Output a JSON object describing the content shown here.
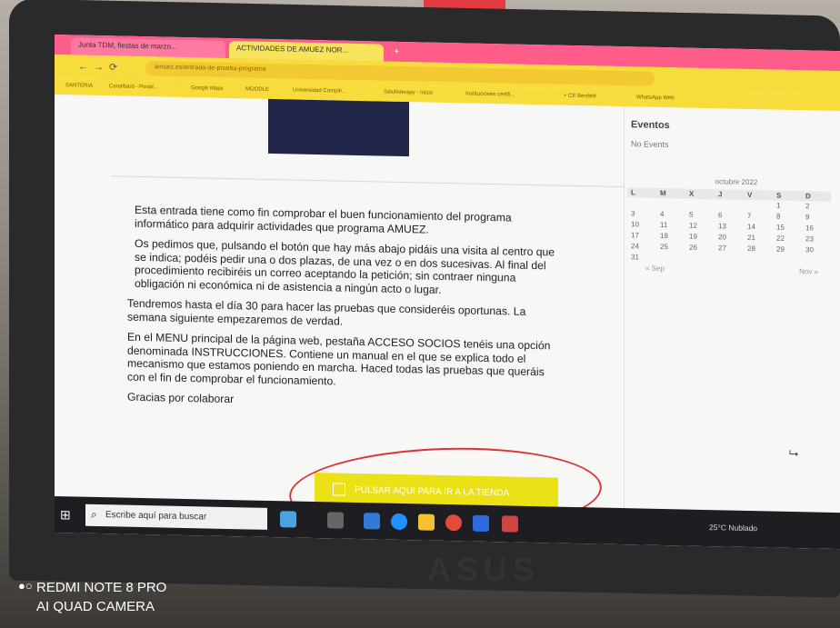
{
  "browser": {
    "tabs": [
      {
        "label": "Junta TDM, fiestas de marzo..."
      },
      {
        "label": "ACTIVIDADES DE AMUEZ NOR..."
      }
    ],
    "new_tab": "+",
    "url": "amuez.es/entrada-de-prueba-programa",
    "bookmarks": [
      "SANTERIA",
      "Canalbard - Portal...",
      "Google Maps",
      "MOODLE",
      "Universidad Comple...",
      "Salufisterapy - Inicio",
      "Instituciones certifi...",
      "+ CE Berdelé",
      "WhatsApp Web"
    ]
  },
  "sidebar": {
    "events_title": "Eventos",
    "events_empty": "No Events",
    "calendar": {
      "month": "octubre 2022",
      "weekdays": [
        "L",
        "M",
        "X",
        "J",
        "V",
        "S",
        "D"
      ],
      "weeks": [
        [
          "",
          "",
          "",
          "",
          "",
          "1",
          "2"
        ],
        [
          "3",
          "4",
          "5",
          "6",
          "7",
          "8",
          "9"
        ],
        [
          "10",
          "11",
          "12",
          "13",
          "14",
          "15",
          "16"
        ],
        [
          "17",
          "18",
          "19",
          "20",
          "21",
          "22",
          "23"
        ],
        [
          "24",
          "25",
          "26",
          "27",
          "28",
          "29",
          "30"
        ],
        [
          "31",
          "",
          "",
          "",
          "",
          "",
          ""
        ]
      ],
      "prev": "« Sep",
      "next": "Nov »"
    }
  },
  "article": {
    "p1": "Esta entrada tiene como fin comprobar el buen funcionamiento del programa informático para adquirir actividades que programa AMUEZ.",
    "p2": "Os pedimos que, pulsando el botón que hay más abajo pidáis una visita al centro que se indica; podéis pedir una o dos plazas, de una vez o en dos sucesivas. Al final del procedimiento recibiréis un correo aceptando la petición; sin contraer ninguna obligación ni económica ni de asistencia a ningún acto o lugar.",
    "p3": "Tendremos hasta el día 30 para hacer las pruebas que consideréis oportunas. La semana siguiente empezaremos de verdad.",
    "p4": "En el MENU principal de la página web, pestaña ACCESO SOCIOS tenéis una opción denominada INSTRUCCIONES. Contiene un manual en el que se explica todo el mecanismo que estamos poniendo en marcha. Haced todas las pruebas que queráis con el fin de comprobar el funcionamiento.",
    "p5": "Gracias por colaborar"
  },
  "shop_button": {
    "label": "PULSAR AQUI PARA IR A LA TIENDA"
  },
  "taskbar": {
    "search_placeholder": "Escribe aquí para buscar",
    "weather": "25°C  Nublado"
  },
  "laptop_brand": "ASUS",
  "camera_watermark": {
    "line1": "REDMI NOTE 8 PRO",
    "line2": "AI QUAD CAMERA"
  },
  "colors": {
    "tab_bar": "#ff5c8a",
    "address_bar": "#f8dc3c",
    "shop_button": "#ece016",
    "annotation_circle": "#dd3333"
  }
}
